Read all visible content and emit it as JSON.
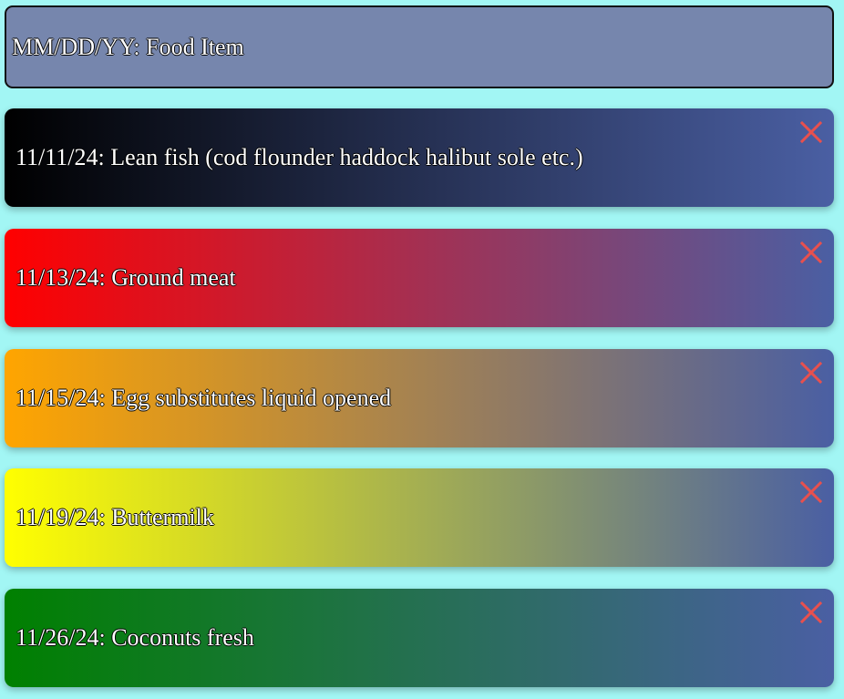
{
  "header": {
    "text": "MM/DD/YY: Food Item"
  },
  "items": [
    {
      "label": "11/11/24: Lean fish (cod flounder haddock halibut sole etc.)",
      "colors": [
        "#000000",
        "#4a5fa3"
      ],
      "close_icon": "close-icon"
    },
    {
      "label": "11/13/24: Ground meat",
      "colors": [
        "#ff0000",
        "#4a5fa3"
      ],
      "close_icon": "close-icon"
    },
    {
      "label": "11/15/24: Egg substitutes liquid opened",
      "colors": [
        "#ffa500",
        "#4a5fa3"
      ],
      "close_icon": "close-icon"
    },
    {
      "label": "11/19/24: Buttermilk",
      "colors": [
        "#ffff00",
        "#4a5fa3"
      ],
      "close_icon": "close-icon"
    },
    {
      "label": "11/26/24: Coconuts fresh",
      "colors": [
        "#008000",
        "#4a5fa3"
      ],
      "close_icon": "close-icon"
    }
  ],
  "close_color": "#e8504e"
}
